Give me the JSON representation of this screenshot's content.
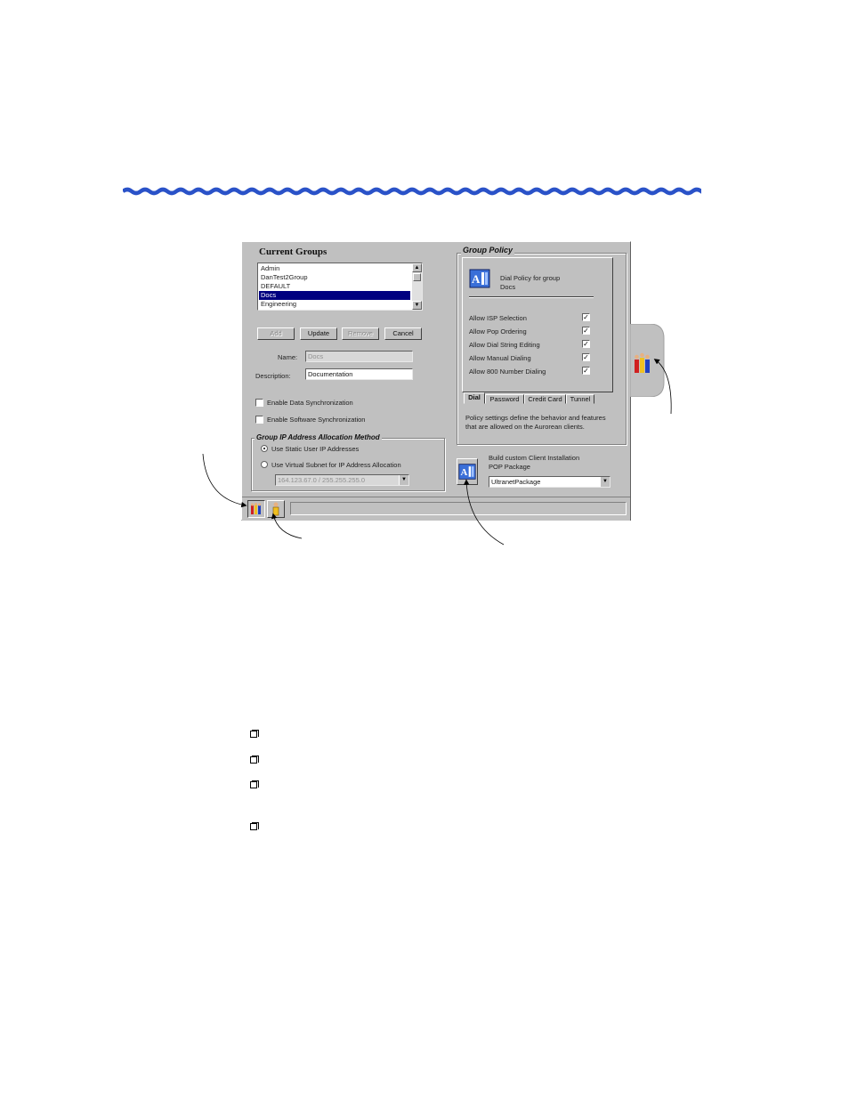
{
  "current_groups": {
    "heading": "Current Groups",
    "items": [
      "Admin",
      "DanTest2Group",
      "DEFAULT",
      "Docs",
      "Engineering"
    ],
    "selected": "Docs"
  },
  "buttons": {
    "add": "Add",
    "update": "Update",
    "remove": "Remove",
    "cancel": "Cancel"
  },
  "form": {
    "name_label": "Name:",
    "name_value": "Docs",
    "description_label": "Description:",
    "description_value": "Documentation",
    "data_sync_label": "Enable Data Synchronization",
    "software_sync_label": "Enable Software Synchronization"
  },
  "ip_allocation": {
    "heading": "Group IP Address Allocation Method",
    "option_static": "Use Static User IP Addresses",
    "option_subnet": "Use Virtual Subnet for IP Address Allocation",
    "subnet_value": "164.123.67.0 / 255.255.255.0"
  },
  "group_policy": {
    "heading": "Group Policy",
    "panel_title_line1": "Dial Policy for group",
    "panel_title_line2": "Docs",
    "options": [
      {
        "label": "Allow ISP Selection",
        "checked": true
      },
      {
        "label": "Allow Pop Ordering",
        "checked": true
      },
      {
        "label": "Allow Dial String Editing",
        "checked": true
      },
      {
        "label": "Allow Manual Dialing",
        "checked": true
      },
      {
        "label": "Allow 800 Number Dialing",
        "checked": true
      }
    ],
    "tabs": [
      "Dial",
      "Password",
      "Credit Card",
      "Tunnel"
    ],
    "active_tab": "Dial",
    "description": "Policy settings define the behavior and features that are allowed on the Aurorean clients."
  },
  "build": {
    "label_line1": "Build custom Client Installation",
    "label_line2": "POP Package",
    "package_value": "UltranetPackage"
  },
  "colors": {
    "accent": "#000080",
    "wave": "#2a52c8",
    "window_bg": "#c0c0c0"
  }
}
